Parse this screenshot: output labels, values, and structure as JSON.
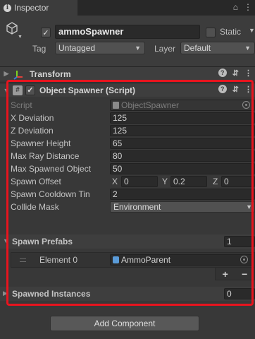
{
  "window": {
    "tab_title": "Inspector",
    "lock_glyph": "⌂",
    "menu_glyph": "⋮"
  },
  "gameobject": {
    "name": "ammoSpawner",
    "active": true,
    "static_label": "Static",
    "tag_label": "Tag",
    "tag_value": "Untagged",
    "layer_label": "Layer",
    "layer_value": "Default"
  },
  "components": {
    "transform": {
      "title": "Transform"
    },
    "object_spawner": {
      "title": "Object Spawner (Script)",
      "enabled": true,
      "properties": {
        "script": {
          "label": "Script",
          "value": "ObjectSpawner"
        },
        "x_deviation": {
          "label": "X Deviation",
          "value": "125"
        },
        "z_deviation": {
          "label": "Z Deviation",
          "value": "125"
        },
        "spawner_height": {
          "label": "Spawner Height",
          "value": "65"
        },
        "max_ray_distance": {
          "label": "Max Ray Distance",
          "value": "80"
        },
        "max_spawned_objects": {
          "label": "Max Spawned Object",
          "value": "50"
        },
        "spawn_offset": {
          "label": "Spawn Offset",
          "x_label": "X",
          "x": "0",
          "y_label": "Y",
          "y": "0.2",
          "z_label": "Z",
          "z": "0"
        },
        "spawn_cooldown_time": {
          "label": "Spawn Cooldown Tin",
          "value": "2"
        },
        "collide_mask": {
          "label": "Collide Mask",
          "value": "Environment"
        }
      },
      "spawn_prefabs": {
        "label": "Spawn Prefabs",
        "size": "1",
        "elements": [
          {
            "label": "Element 0",
            "value": "AmmoParent"
          }
        ],
        "add_label": "+",
        "remove_label": "−"
      },
      "spawned_instances": {
        "label": "Spawned Instances",
        "size": "0"
      }
    }
  },
  "footer": {
    "add_component_label": "Add Component"
  },
  "colors": {
    "highlight": "#e8141e",
    "background": "#383838"
  }
}
